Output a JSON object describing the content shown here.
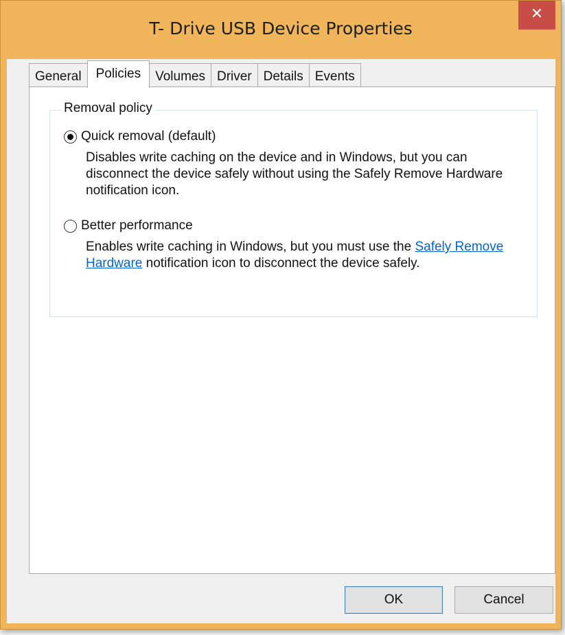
{
  "window": {
    "title": "T- Drive USB Device Properties",
    "close_glyph": "✕"
  },
  "tabs": [
    {
      "label": "General"
    },
    {
      "label": "Policies"
    },
    {
      "label": "Volumes"
    },
    {
      "label": "Driver"
    },
    {
      "label": "Details"
    },
    {
      "label": "Events"
    }
  ],
  "active_tab": "Policies",
  "removal_policy": {
    "group_label": "Removal policy",
    "quick": {
      "label": "Quick removal (default)",
      "description": "Disables write caching on the device and in Windows, but you can disconnect the device safely without using the Safely Remove Hardware notification icon.",
      "selected": true
    },
    "better": {
      "label": "Better performance",
      "desc_before": "Enables write caching in Windows, but you must use the ",
      "desc_link": "Safely Remove Hardware",
      "desc_after": " notification icon to disconnect the device safely.",
      "selected": false
    }
  },
  "buttons": {
    "ok": "OK",
    "cancel": "Cancel"
  },
  "colors": {
    "titlebar": "#f0b55a",
    "close_button": "#c74d46",
    "link": "#0066cc"
  }
}
